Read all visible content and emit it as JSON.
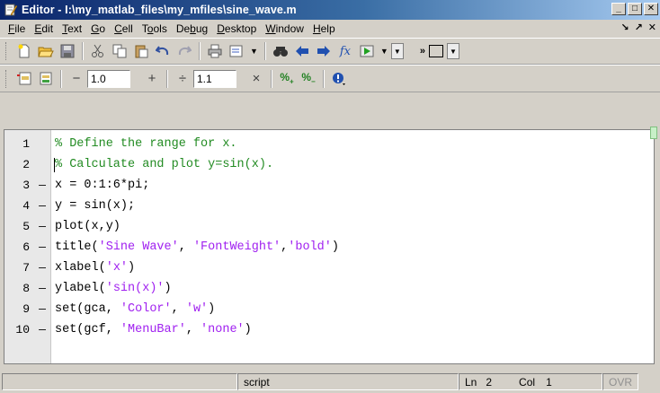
{
  "window": {
    "title": "Editor - I:\\my_matlab_files\\my_mfiles\\sine_wave.m",
    "min_glyph": "_",
    "max_glyph": "□",
    "close_glyph": "✕"
  },
  "menu": {
    "items": [
      {
        "label": "File",
        "key": "F",
        "rest": "ile"
      },
      {
        "label": "Edit",
        "key": "E",
        "rest": "dit"
      },
      {
        "label": "Text",
        "key": "T",
        "rest": "ext"
      },
      {
        "label": "Go",
        "key": "G",
        "rest": "o"
      },
      {
        "label": "Cell",
        "key": "C",
        "rest": "ell"
      },
      {
        "label": "Tools",
        "pre": "T",
        "key": "o",
        "rest": "ols"
      },
      {
        "label": "Debug",
        "pre": "De",
        "key": "b",
        "rest": "ug"
      },
      {
        "label": "Desktop",
        "key": "D",
        "rest": "esktop"
      },
      {
        "label": "Window",
        "key": "W",
        "rest": "indow"
      },
      {
        "label": "Help",
        "key": "H",
        "rest": "elp"
      }
    ],
    "right_dock_glyph": "↘",
    "right_undock_glyph": "↗",
    "right_close_glyph": "✕"
  },
  "toolbar1": {
    "icons": [
      "new-file-icon",
      "open-file-icon",
      "save-icon",
      "cut-icon",
      "copy-icon",
      "paste-icon",
      "undo-icon",
      "redo-icon",
      "print-icon",
      "dropdown-list-icon",
      "find-icon",
      "back-icon",
      "forward-icon",
      "function-icon",
      "run-icon"
    ],
    "function_label": "fx"
  },
  "toolbar2": {
    "decrement_label": "−",
    "increment_label": "+",
    "divide_label": "÷",
    "multiply_label": "×",
    "field1_value": "1.0",
    "field2_value": "1.1"
  },
  "code": {
    "lines": [
      {
        "num": "1",
        "dash": "",
        "parts": [
          {
            "t": "% Define the range for x.",
            "c": "comment"
          }
        ]
      },
      {
        "num": "2",
        "dash": "",
        "parts": [
          {
            "t": "% Calculate and plot y=sin(x).",
            "c": "comment"
          }
        ]
      },
      {
        "num": "3",
        "dash": "—",
        "parts": [
          {
            "t": "x = 0:1:6*pi;",
            "c": "plain"
          }
        ]
      },
      {
        "num": "4",
        "dash": "—",
        "parts": [
          {
            "t": "y = sin(x);",
            "c": "plain"
          }
        ]
      },
      {
        "num": "5",
        "dash": "—",
        "parts": [
          {
            "t": "plot(x,y)",
            "c": "plain"
          }
        ]
      },
      {
        "num": "6",
        "dash": "—",
        "parts": [
          {
            "t": "title(",
            "c": "plain"
          },
          {
            "t": "'Sine Wave'",
            "c": "str"
          },
          {
            "t": ", ",
            "c": "plain"
          },
          {
            "t": "'FontWeight'",
            "c": "str"
          },
          {
            "t": ",",
            "c": "plain"
          },
          {
            "t": "'bold'",
            "c": "str"
          },
          {
            "t": ")",
            "c": "plain"
          }
        ]
      },
      {
        "num": "7",
        "dash": "—",
        "parts": [
          {
            "t": "xlabel(",
            "c": "plain"
          },
          {
            "t": "'x'",
            "c": "str"
          },
          {
            "t": ")",
            "c": "plain"
          }
        ]
      },
      {
        "num": "8",
        "dash": "—",
        "parts": [
          {
            "t": "ylabel(",
            "c": "plain"
          },
          {
            "t": "'sin(x)'",
            "c": "str"
          },
          {
            "t": ")",
            "c": "plain"
          }
        ]
      },
      {
        "num": "9",
        "dash": "—",
        "parts": [
          {
            "t": "set(gca, ",
            "c": "plain"
          },
          {
            "t": "'Color'",
            "c": "str"
          },
          {
            "t": ", ",
            "c": "plain"
          },
          {
            "t": "'w'",
            "c": "str"
          },
          {
            "t": ")",
            "c": "plain"
          }
        ]
      },
      {
        "num": "10",
        "dash": "—",
        "parts": [
          {
            "t": "set(gcf, ",
            "c": "plain"
          },
          {
            "t": "'MenuBar'",
            "c": "str"
          },
          {
            "t": ", ",
            "c": "plain"
          },
          {
            "t": "'none'",
            "c": "str"
          },
          {
            "t": ")",
            "c": "plain"
          }
        ]
      }
    ],
    "caret_line": 2
  },
  "status": {
    "mode": "script",
    "ln_label": "Ln",
    "ln_value": "2",
    "col_label": "Col",
    "col_value": "1",
    "ovr": "OVR"
  },
  "colors": {
    "comment": "#228b22",
    "string": "#a020f0",
    "title_bar": "#0a246a"
  }
}
